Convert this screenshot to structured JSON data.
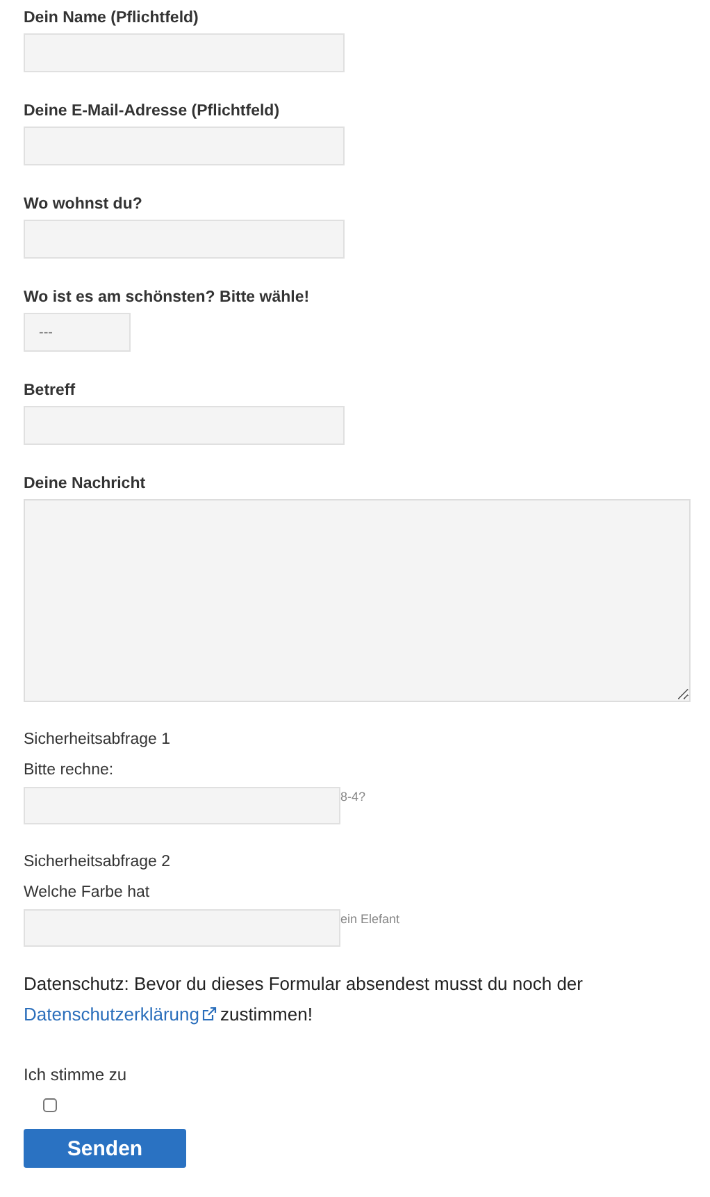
{
  "fields": [
    {
      "kind": "text",
      "label": "Dein Name (Pflichtfeld)"
    },
    {
      "kind": "text",
      "label": "Deine E-Mail-Adresse (Pflichtfeld)"
    },
    {
      "kind": "text",
      "label": "Wo wohnst du?"
    },
    {
      "kind": "select",
      "label": "Wo ist es am schönsten? Bitte wähle!",
      "value": "---"
    },
    {
      "kind": "text",
      "label": "Betreff"
    },
    {
      "kind": "textarea",
      "label": "Deine Nachricht"
    },
    {
      "kind": "captcha",
      "heading": "Sicherheitsabfrage 1",
      "label": "Bitte rechne:",
      "hint": "8-4?"
    },
    {
      "kind": "captcha",
      "heading": "Sicherheitsabfrage 2",
      "label": "Welche Farbe hat",
      "hint": "ein Elefant"
    }
  ],
  "privacy": {
    "text": "Datenschutz: Bevor du dieses Formular absendest musst du noch der",
    "link": "Datenschutzerklärung",
    "after": "zustimmen!"
  },
  "consent": {
    "label": "Ich stimme zu",
    "checked": false
  },
  "submit": "Senden"
}
